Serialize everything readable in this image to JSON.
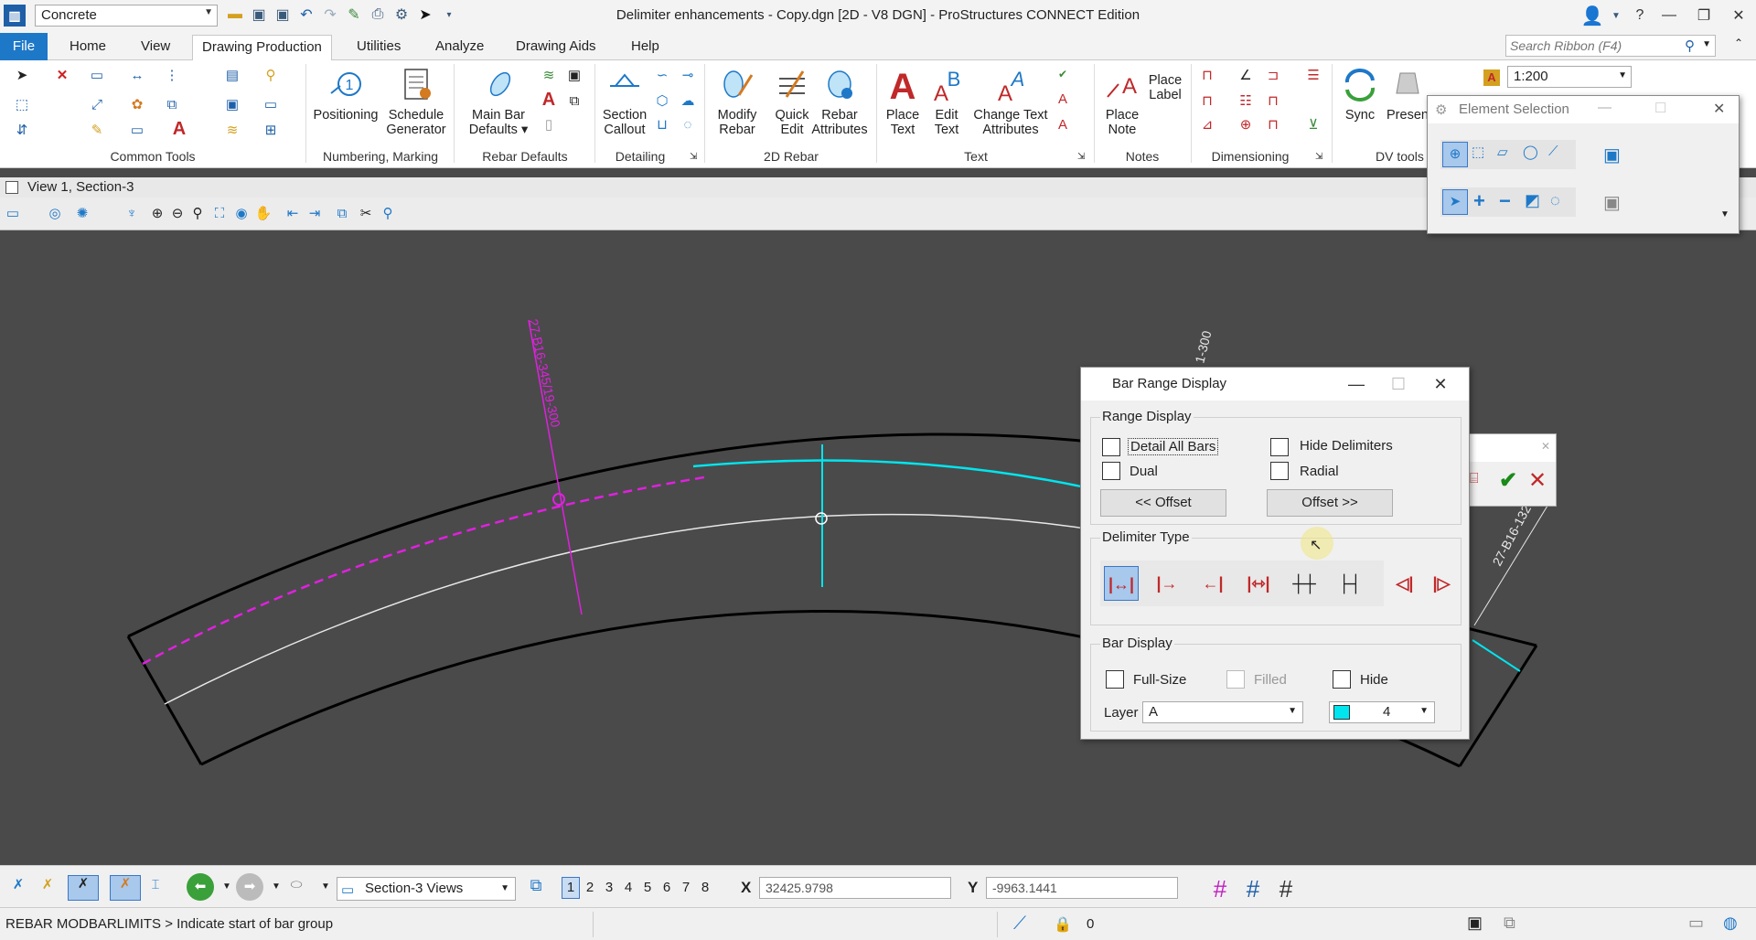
{
  "app": {
    "title": "Delimiter enhancements - Copy.dgn [2D - V8 DGN] - ProStructures CONNECT Edition",
    "workset": "Concrete"
  },
  "ribbon": {
    "tabs": [
      "File",
      "Home",
      "View",
      "Drawing Production",
      "Utilities",
      "Analyze",
      "Drawing Aids",
      "Help"
    ],
    "search_placeholder": "Search Ribbon (F4)",
    "scale": "1:200",
    "groups": {
      "common_tools": "Common Tools",
      "numbering": "Numbering, Marking",
      "rebar_defaults": "Rebar Defaults",
      "detailing": "Detailing",
      "rebar_2d": "2D Rebar",
      "text": "Text",
      "notes": "Notes",
      "dimensioning": "Dimensioning",
      "dv_tools": "DV tools"
    },
    "buttons": {
      "positioning": "Positioning",
      "schedule_1": "Schedule",
      "schedule_2": "Generator",
      "mainbar_1": "Main Bar",
      "mainbar_2": "Defaults",
      "section_1": "Section",
      "section_2": "Callout",
      "modify_1": "Modify",
      "modify_2": "Rebar",
      "quick_1": "Quick",
      "quick_2": "Edit",
      "rebarattr_1": "Rebar",
      "rebarattr_2": "Attributes",
      "placetext_1": "Place",
      "placetext_2": "Text",
      "edittext_1": "Edit",
      "edittext_2": "Text",
      "change_1": "Change Text",
      "change_2": "Attributes",
      "placenote_1": "Place",
      "placenote_2": "Note",
      "placelabel_1": "Place",
      "placelabel_2": "Label",
      "sync": "Sync",
      "present": "Presen"
    }
  },
  "view": {
    "title": "View 1, Section-3"
  },
  "canvas": {
    "label_left": "27-B16-345/19-300",
    "label_top": "1-300",
    "label_right": "27-B16-132"
  },
  "element_selection": {
    "title": "Element Selection"
  },
  "bar_range_dialog": {
    "title": "Bar Range Display",
    "range_display": {
      "label": "Range Display",
      "detail_all_bars": "Detail All Bars",
      "hide_delimiters": "Hide Delimiters",
      "dual": "Dual",
      "radial": "Radial",
      "offset_left": "<< Offset",
      "offset_right": "Offset >>"
    },
    "delimiter_type": {
      "label": "Delimiter Type"
    },
    "bar_display": {
      "label": "Bar Display",
      "full_size": "Full-Size",
      "filled": "Filled",
      "hide": "Hide",
      "layer_label": "Layer",
      "layer_value": "A",
      "color_value": "4"
    }
  },
  "bottom": {
    "view_group": "Section-3 Views",
    "views": [
      "1",
      "2",
      "3",
      "4",
      "5",
      "6",
      "7",
      "8"
    ],
    "x_label": "X",
    "x_value": "32425.9798",
    "y_label": "Y",
    "y_value": "-9963.1441"
  },
  "status": {
    "prompt": "REBAR MODBARLIMITS  > Indicate start of bar group",
    "level": "0"
  },
  "colors": {
    "accent": "#1e78c8",
    "cyan": "#00e5ee",
    "magenta": "#e020e0",
    "rebar_red": "#c0282a"
  }
}
